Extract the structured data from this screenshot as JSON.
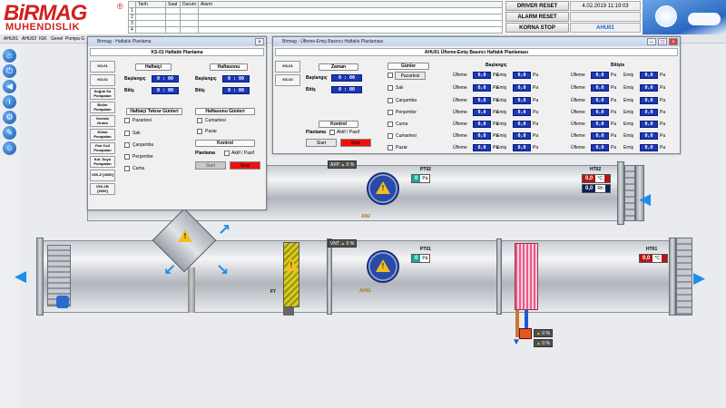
{
  "brand": {
    "logo_main": "BiRMAG",
    "logo_sub": "MUHENDISLIK",
    "logo_mark": "®"
  },
  "alarm_table": {
    "headers": [
      "",
      "Tarih",
      "Saat",
      "Durum",
      "Alarm"
    ],
    "rows": [
      [
        "1",
        "",
        "",
        "",
        ""
      ],
      [
        "2",
        "",
        "",
        "",
        ""
      ],
      [
        "3",
        "",
        "",
        "",
        ""
      ],
      [
        "4",
        "",
        "",
        "",
        ""
      ]
    ]
  },
  "header": {
    "driver_reset": "DRIVER RESET",
    "alarm_reset": "ALARM RESET",
    "korna_stop": "KORNA STOP",
    "datetime": "4.02.2019 11:19:03",
    "unit": "AHU01"
  },
  "nav": {
    "items": [
      "AHU01",
      "AHU02",
      "IGK",
      "Genel",
      "Pompa G"
    ]
  },
  "sidebar": {
    "icons": [
      "home-icon",
      "power-icon",
      "back-icon",
      "info-icon",
      "settings-icon",
      "tools-icon",
      "user-icon"
    ]
  },
  "process": {
    "axp": {
      "label": "AXP",
      "value": "0",
      "unit": "%"
    },
    "vnt": {
      "label": "VNT",
      "value": "0",
      "unit": "%"
    },
    "pt02": {
      "label": "PT02",
      "value": "0",
      "unit": "Pa"
    },
    "pt01": {
      "label": "PT01",
      "value": "0",
      "unit": "Pa"
    },
    "ht02": {
      "label": "HT02",
      "temp": "0,0",
      "temp_unit": "°C",
      "hum": "0,0",
      "hum_unit": "Rh"
    },
    "ht01": {
      "label": "HT01",
      "temp": "0,0",
      "temp_unit": "°C"
    },
    "fan_upper_label": "AN2",
    "fan_lower_label": "AVN1",
    "filter_label": "F7",
    "valve_readout_1": "0",
    "valve_readout_2": "0",
    "valve_readout_unit": "%"
  },
  "win_ks01": {
    "title": "Birmag - Haftalık Planlama",
    "panel_title": "KS-01 Haftalık Planlama",
    "tabs": [
      "KS-01",
      "KS-02",
      "Soğuk Su Pompaları",
      "Boiler Pompaları",
      "Konsta Grubu",
      "Klima Pompaları",
      "Fan Coil Pompaları",
      "Kul. Suyu Pompaları",
      "IGK-Z [4000]",
      "IGK-1B [3000]"
    ],
    "haftaici": "Haftaiçi",
    "haftasonu": "Haftasonu",
    "baslangic": "Başlangıç",
    "bitis": "Bitiş",
    "time": "0 : 00",
    "tekrar_title": "Haftaiçi Tekrar Günleri",
    "hs_title": "Haftasonu Günleri",
    "weekdays": [
      "Pazartesi",
      "Salı",
      "Çarşamba",
      "Perşembe",
      "Cuma"
    ],
    "weekend": [
      "Cumartesi",
      "Pazar"
    ],
    "kontrol": "Kontrol",
    "planlama": "Planlama",
    "aktif_pasif": "Aktif / Pasif",
    "start": "Start",
    "stop": "Stop"
  },
  "win_ahu": {
    "title": "Birmag - Üfleme-Emiş Basıncı Haftalık Planlaması",
    "panel_title": "AHU01 Üfleme-Emiş Basıncı Haftalık Planlaması",
    "tabs": [
      "KS-01",
      "KS-02"
    ],
    "zaman": "Zaman",
    "baslangic": "Başlangıç",
    "bitis": "Bitiş",
    "time": "0 : 00",
    "gunler": "Günler",
    "days": [
      "Pazartesi",
      "Salı",
      "Çarşamba",
      "Perşembe",
      "Cuma",
      "Cumartesi",
      "Pazar"
    ],
    "baslangic_col": "Başlangıç",
    "bitis_col": "Bitişte",
    "ufleme": "Üfleme",
    "emis": "Emiş",
    "pa_value": "0,0",
    "pa_unit": "Pa",
    "kontrol": "Kontrol",
    "planlama": "Planlama",
    "aktif_pasif": "Aktif / Pasif",
    "start": "Start",
    "stop": "Stop"
  }
}
